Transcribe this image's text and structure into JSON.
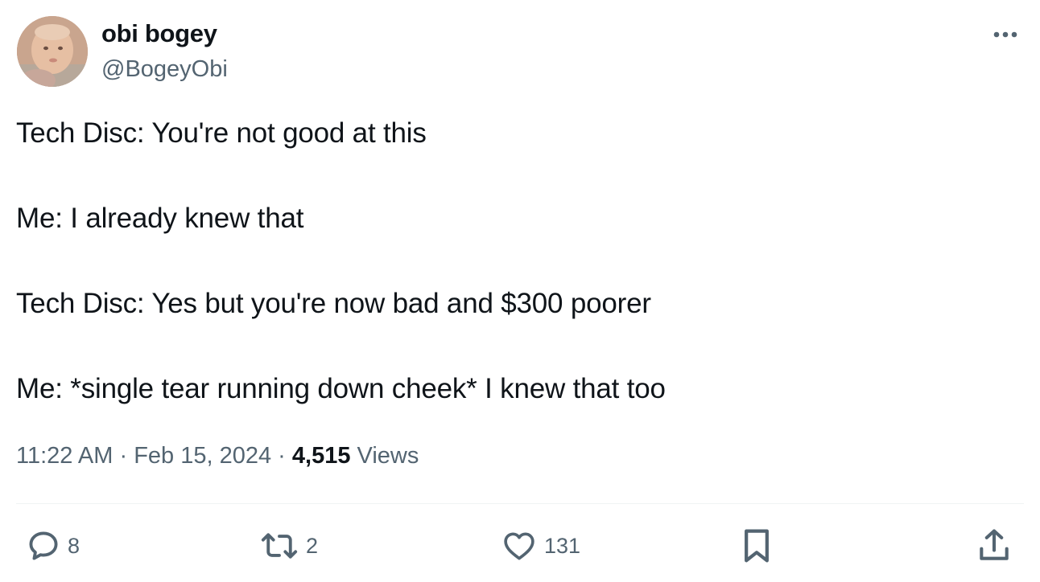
{
  "author": {
    "display_name": "obi bogey",
    "handle": "@BogeyObi"
  },
  "tweet": {
    "lines": [
      "Tech Disc: You're not good at this",
      "Me: I already knew that",
      "Tech Disc: Yes but you're now bad and $300 poorer",
      "Me: *single tear running down cheek* I knew that too"
    ],
    "time": "11:22 AM",
    "separator": "·",
    "date": "Feb 15, 2024",
    "views_count": "4,515",
    "views_label": "Views"
  },
  "actions": {
    "replies": "8",
    "retweets": "2",
    "likes": "131"
  },
  "icons": {
    "more": "more-horizontal-icon",
    "reply": "reply-bubble-icon",
    "retweet": "retweet-icon",
    "like": "heart-icon",
    "bookmark": "bookmark-icon",
    "share": "share-upload-icon"
  },
  "colors": {
    "text": "#0f1419",
    "secondary": "#536471",
    "divider": "#eff3f4"
  }
}
